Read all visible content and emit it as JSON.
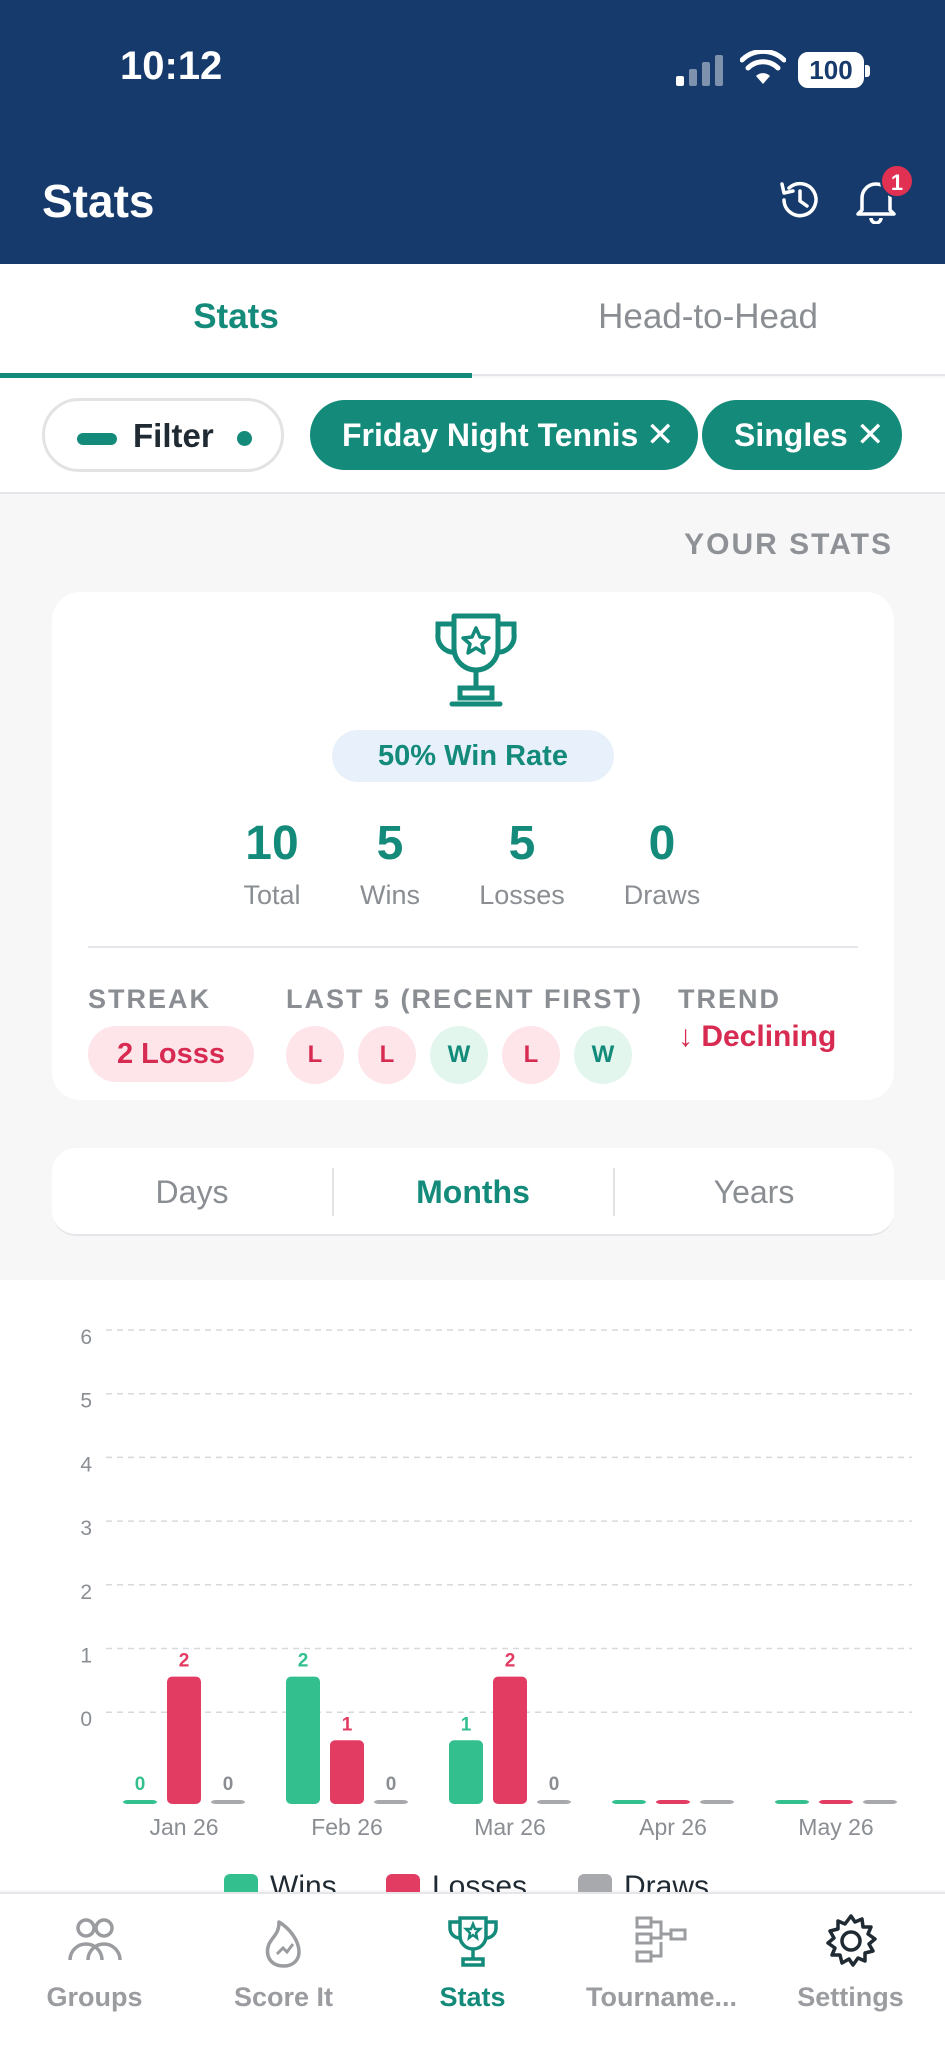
{
  "status_bar": {
    "time": "10:12",
    "battery": "100"
  },
  "header": {
    "title": "Stats",
    "notification_count": "1"
  },
  "tabs": [
    {
      "label": "Stats",
      "active": true
    },
    {
      "label": "Head-to-Head",
      "active": false
    }
  ],
  "filter": {
    "button_label": "Filter",
    "chips": [
      {
        "label": "Friday Night Tennis"
      },
      {
        "label": "Singles"
      }
    ],
    "remove_glyph": "✕"
  },
  "your_stats": {
    "section_label": "YOUR STATS",
    "win_rate": "50% Win Rate",
    "totals": [
      {
        "value": "10",
        "label": "Total"
      },
      {
        "value": "5",
        "label": "Wins"
      },
      {
        "value": "5",
        "label": "Losses"
      },
      {
        "value": "0",
        "label": "Draws"
      }
    ],
    "streak_label": "STREAK",
    "streak_value": "2 Losss",
    "last5_label": "LAST 5 (RECENT FIRST)",
    "last5": [
      "L",
      "L",
      "W",
      "L",
      "W"
    ],
    "trend_label": "TREND",
    "trend_value": "↓ Declining"
  },
  "period_toggle": {
    "options": [
      "Days",
      "Months",
      "Years"
    ],
    "selected": "Months"
  },
  "chart_data": {
    "type": "bar",
    "categories": [
      "Jan 26",
      "Feb 26",
      "Mar 26",
      "Apr 26",
      "May 26"
    ],
    "series": [
      {
        "name": "Wins",
        "color": "#34c08e",
        "values": [
          0,
          2,
          1,
          0,
          0
        ]
      },
      {
        "name": "Losses",
        "color": "#e23c63",
        "values": [
          2,
          1,
          2,
          0,
          0
        ]
      },
      {
        "name": "Draws",
        "color": "#a8a9ad",
        "values": [
          0,
          0,
          0,
          0,
          0
        ]
      }
    ],
    "data_labels": [
      [
        "0",
        "2",
        "1",
        "",
        ""
      ],
      [
        "2",
        "1",
        "2",
        "",
        ""
      ],
      [
        "0",
        "0",
        "0",
        "",
        ""
      ]
    ],
    "y_ticks": [
      "6",
      "5",
      "4",
      "3",
      "2",
      "1",
      "0"
    ],
    "ylim": [
      0,
      6
    ],
    "grid": true,
    "legend_position": "bottom"
  },
  "bottom_nav": [
    {
      "label": "Groups",
      "icon": "groups-icon",
      "active": false
    },
    {
      "label": "Score It",
      "icon": "flame-icon",
      "active": false
    },
    {
      "label": "Stats",
      "icon": "trophy-icon",
      "active": true
    },
    {
      "label": "Tourname...",
      "icon": "bracket-icon",
      "active": false
    },
    {
      "label": "Settings",
      "icon": "gear-icon",
      "active": false
    }
  ],
  "colors": {
    "header": "#163a6b",
    "accent": "#138a7a",
    "loss": "#d72b52"
  }
}
